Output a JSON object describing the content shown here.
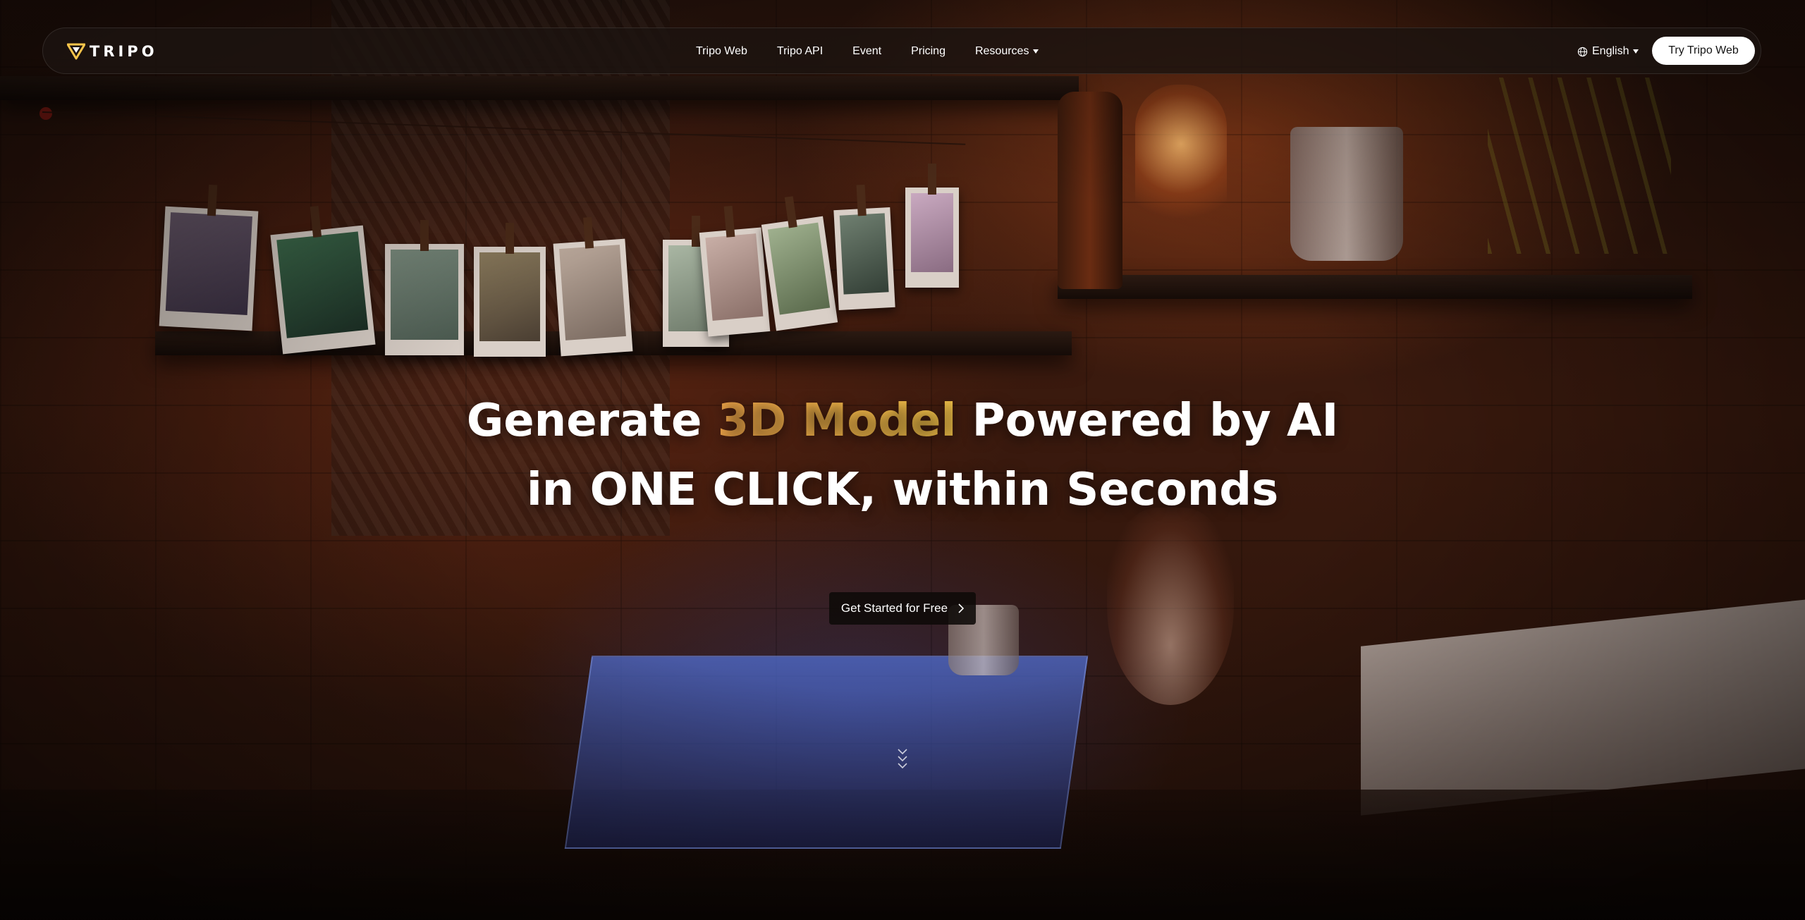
{
  "brand": {
    "logo_text": "TRIPO",
    "logo_icon": "tripo-v-logo-icon"
  },
  "nav": {
    "links": [
      {
        "label": "Tripo Web"
      },
      {
        "label": "Tripo API"
      },
      {
        "label": "Event"
      },
      {
        "label": "Pricing"
      }
    ],
    "resources_label": "Resources",
    "resources_icon": "caret-down-icon",
    "language_label": "English",
    "language_icon": "globe-icon",
    "cta_label": "Try Tripo Web"
  },
  "hero": {
    "line1_prefix": "Generate ",
    "line1_accent": "3D Model",
    "line1_suffix": " Powered by AI",
    "line2": "in ONE CLICK, within Seconds",
    "accent_colors": [
      "#f3a74a",
      "#f6c54a"
    ],
    "button_label": "Get Started for Free",
    "button_icon": "chevron-right-icon",
    "scroll_icon": "double-chevron-down-icon"
  }
}
